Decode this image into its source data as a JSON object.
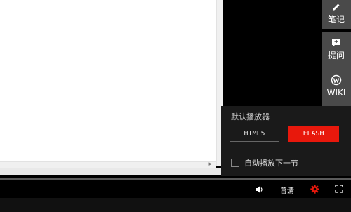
{
  "side_tools": [
    {
      "label": "笔记",
      "icon": "pencil-icon"
    },
    {
      "label": "提问",
      "icon": "question-bubble-icon"
    },
    {
      "label": "WIKI",
      "icon": "wiki-icon"
    }
  ],
  "settings": {
    "title": "默认播放器",
    "html5_label": "HTML5",
    "flash_label": "FLASH",
    "autoplay_label": "自动播放下一节",
    "active_color": "#e8180c"
  },
  "controls": {
    "quality_label": "普清",
    "volume_icon": "volume-icon",
    "settings_icon": "gear-icon",
    "fullscreen_icon": "fullscreen-icon"
  }
}
